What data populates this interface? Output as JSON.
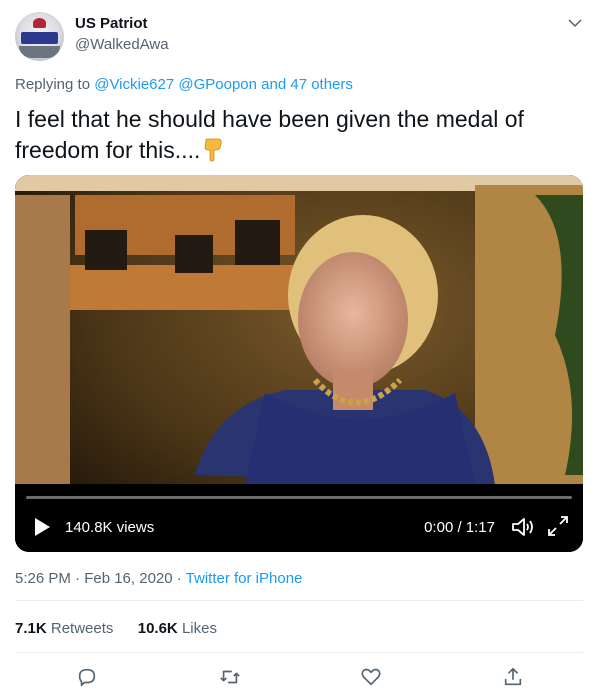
{
  "author": {
    "name": "US Patriot",
    "handle": "@WalkedAwa",
    "avatar": "badge-avatar"
  },
  "reply": {
    "prefix": "Replying to",
    "mentions": "@Vickie627 @GPoopon and 47 others"
  },
  "tweet": {
    "text": "I feel that he should have been given the medal of freedom for this....",
    "emoji": "backhand-index-pointing-down"
  },
  "video": {
    "views": "140.8K views",
    "time": "0:00 / 1:17",
    "icons": [
      "play-icon",
      "volume-icon",
      "fullscreen-icon"
    ]
  },
  "meta": {
    "timestamp": "5:26 PM · Feb 16, 2020 · ",
    "source": "Twitter for iPhone"
  },
  "stats": {
    "retweets_count": "7.1K",
    "retweets_label": "Retweets",
    "likes_count": "10.6K",
    "likes_label": "Likes"
  },
  "actions": [
    "reply-icon",
    "retweet-icon",
    "like-icon",
    "share-icon"
  ],
  "colors": {
    "link": "#1d9bf0",
    "secondary_text": "#536471",
    "primary_text": "#0f1419"
  }
}
